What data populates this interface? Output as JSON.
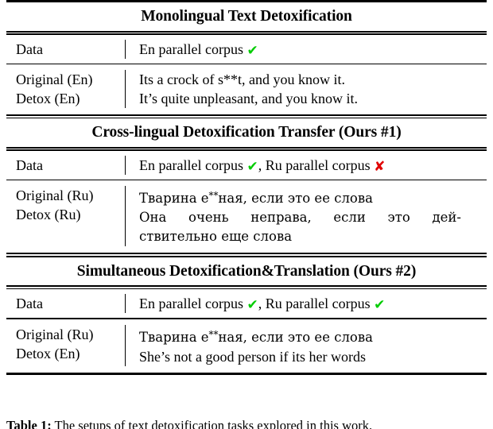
{
  "marks": {
    "check": "✔",
    "cross": "✘",
    "check_color": "#00cc00",
    "cross_color": "#e00000"
  },
  "sections": [
    {
      "header": "Monolingual Text Detoxification",
      "data_label": "Data",
      "data_parts": [
        {
          "text": "En parallel corpus ",
          "mark": "check"
        }
      ],
      "example_rows": [
        {
          "label": "Original (En)",
          "lines": [
            "Its a crock of s**t, and you know it."
          ]
        },
        {
          "label": "Detox (En)",
          "lines": [
            "It’s quite unpleasant, and you know it."
          ]
        }
      ]
    },
    {
      "header": "Cross-lingual Detoxification Transfer (Ours #1)",
      "data_label": "Data",
      "data_parts": [
        {
          "text": "En parallel corpus ",
          "mark": "check"
        },
        {
          "text": ", Ru parallel corpus ",
          "mark": "cross"
        }
      ],
      "example_rows": [
        {
          "label": "Original (Ru)",
          "ru": true,
          "lines_rich": [
            {
              "pre": "Тварина е",
              "stars": "**",
              "post": "ная, если это ее слова"
            }
          ]
        },
        {
          "label": "Detox (Ru)",
          "ru": true,
          "lines": [
            "Она очень неправа, если это дей-",
            "ствительно еще слова"
          ],
          "justify_first": true
        }
      ]
    },
    {
      "header": "Simultaneous Detoxification&Translation (Ours #2)",
      "data_label": "Data",
      "data_parts": [
        {
          "text": "En parallel corpus ",
          "mark": "check"
        },
        {
          "text": ", Ru parallel corpus ",
          "mark": "check"
        }
      ],
      "example_rows": [
        {
          "label": "Original (Ru)",
          "ru": true,
          "lines_rich": [
            {
              "pre": "Тварина е",
              "stars": "**",
              "post": "ная, если это ее слова"
            }
          ]
        },
        {
          "label": "Detox (En)",
          "lines": [
            "She’s not a good person if its her words"
          ]
        }
      ]
    }
  ],
  "caption": {
    "label": "Table 1:",
    "text": "The setups of text detoxification tasks explored in this work."
  }
}
